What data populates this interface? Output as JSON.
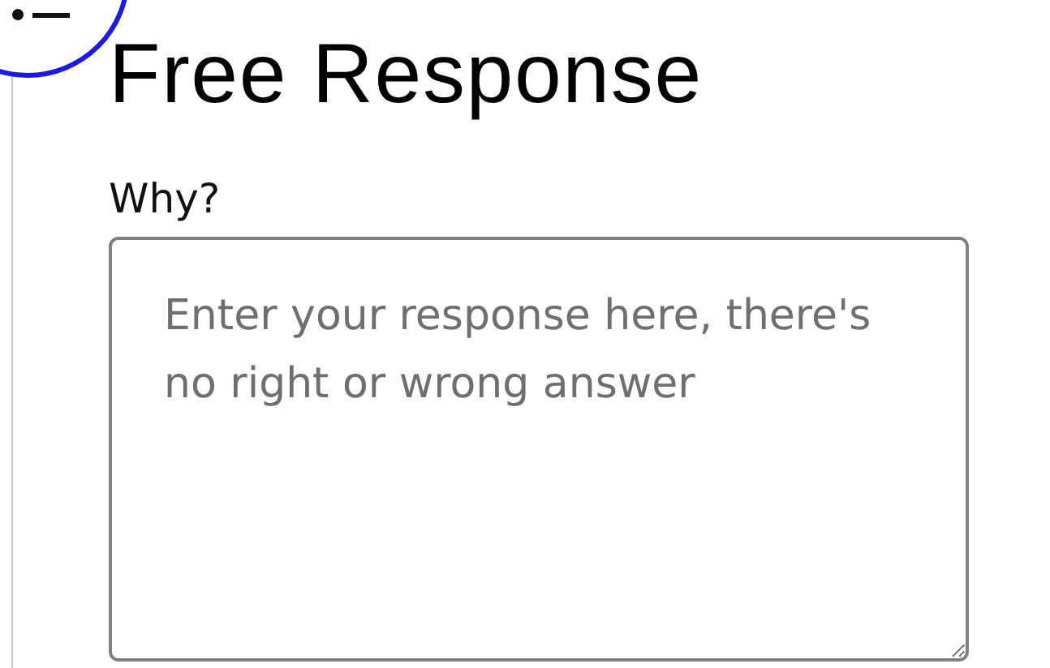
{
  "title": "Free Response",
  "question": {
    "label": "Why?",
    "placeholder": "Enter your response here, there's no right or wrong answer"
  }
}
